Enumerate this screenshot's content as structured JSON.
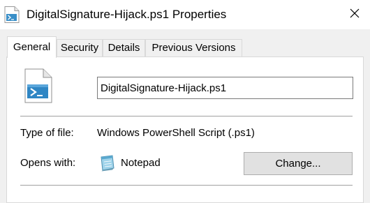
{
  "window": {
    "title": "DigitalSignature-Hijack.ps1 Properties"
  },
  "tabs": [
    {
      "label": "General",
      "active": true
    },
    {
      "label": "Security",
      "active": false
    },
    {
      "label": "Details",
      "active": false
    },
    {
      "label": "Previous Versions",
      "active": false
    }
  ],
  "general": {
    "file_name": "DigitalSignature-Hijack.ps1",
    "type_label": "Type of file:",
    "type_value": "Windows PowerShell Script (.ps1)",
    "opens_label": "Opens with:",
    "opens_value": "Notepad",
    "change_label": "Change..."
  },
  "icons": {
    "title": "powershell-script-icon",
    "file": "powershell-script-icon",
    "app": "notepad-icon",
    "close": "close-icon"
  }
}
